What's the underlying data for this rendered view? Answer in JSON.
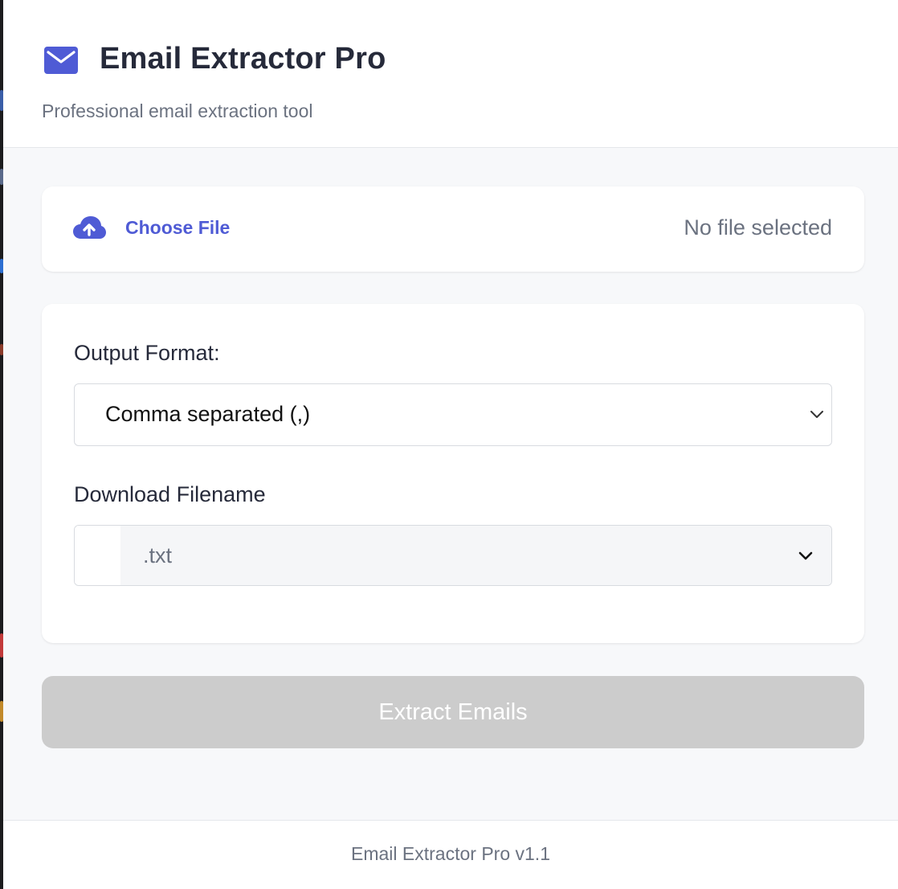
{
  "app": {
    "title": "Email Extractor Pro",
    "subtitle": "Professional email extraction tool"
  },
  "icons": {
    "logo": "envelope-icon",
    "upload": "cloud-upload-icon",
    "dropdown": "chevron-down-icon"
  },
  "file_picker": {
    "button_label": "Choose File",
    "status": "No file selected"
  },
  "options": {
    "output_format_label": "Output Format:",
    "output_format_value": "Comma separated (,)",
    "filename_label": "Download Filename",
    "filename_value": "",
    "extension_value": ".txt"
  },
  "actions": {
    "extract_label": "Extract Emails",
    "extract_enabled": false
  },
  "footer": {
    "version_text": "Email Extractor Pro v1.1"
  },
  "colors": {
    "accent": "#4f5bd5",
    "title_text": "#262a3a",
    "muted_text": "#6b7280",
    "disabled_button": "#cccccc",
    "page_background": "#f7f8fa"
  }
}
